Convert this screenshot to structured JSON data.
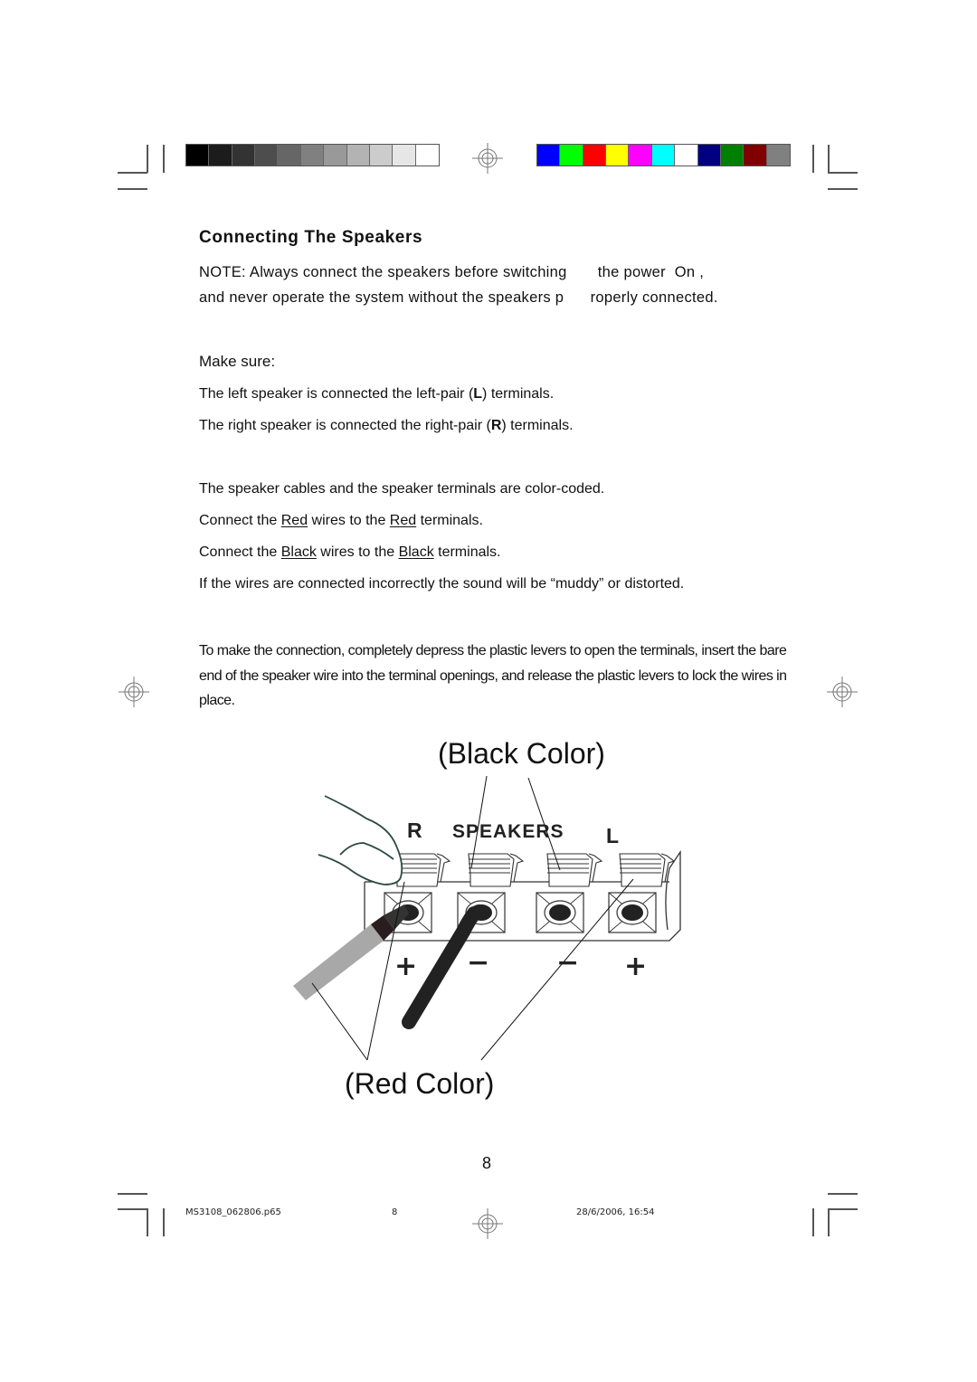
{
  "print_marks": {
    "grayscale_bar": [
      "#000000",
      "#1c1c1c",
      "#333333",
      "#4d4d4d",
      "#666666",
      "#808080",
      "#999999",
      "#b3b3b3",
      "#cccccc",
      "#e6e6e6",
      "#ffffff"
    ],
    "color_bar": [
      "#0000ff",
      "#00ff00",
      "#ff0000",
      "#ffff00",
      "#ff00ff",
      "#00ffff",
      "#ffffff",
      "#000080",
      "#008000",
      "#800000",
      "#808080"
    ]
  },
  "section": {
    "heading": "Connecting The Speakers",
    "note_line1": "NOTE: Always connect the speakers before switching       the power  On ,",
    "note_line2": "and never operate the system without the speakers p      roperly connected.",
    "make_sure_label": "Make sure:",
    "make_sure_items": [
      {
        "before": "The left speaker is connected the left-pair (",
        "bold": "L",
        "after": ") terminals."
      },
      {
        "before": "The right speaker is connected the right-pair (",
        "bold": "R",
        "after": ") terminals."
      }
    ],
    "color_coded": "The speaker cables and the speaker terminals are color-coded.",
    "red_line": {
      "a": "Connect the ",
      "u1": "Red",
      "b": " wires to the ",
      "u2": "Red",
      "c": " terminals."
    },
    "black_line": {
      "a": "Connect the ",
      "u1": "Black",
      "b": " wires to the ",
      "u2": "Black",
      "c": " terminals."
    },
    "incorrect": "If the wires are connected incorrectly the sound will be “muddy” or distorted.",
    "lever_instructions": "To make the connection, completely depress the plastic levers to open the terminals, insert the bare end of the speaker wire into the terminal openings, and release the plastic levers to lock the wires in place."
  },
  "diagram": {
    "black_label": "(Black Color)",
    "red_label": "(Red Color)",
    "panel_r": "R",
    "panel_title": "SPEAKERS",
    "panel_l": "L",
    "polarity": [
      "+",
      "−",
      "−",
      "+"
    ]
  },
  "footer": {
    "page_number": "8",
    "file_name": "MS3108_062806.p65",
    "file_page": "8",
    "timestamp": "28/6/2006, 16:54"
  }
}
